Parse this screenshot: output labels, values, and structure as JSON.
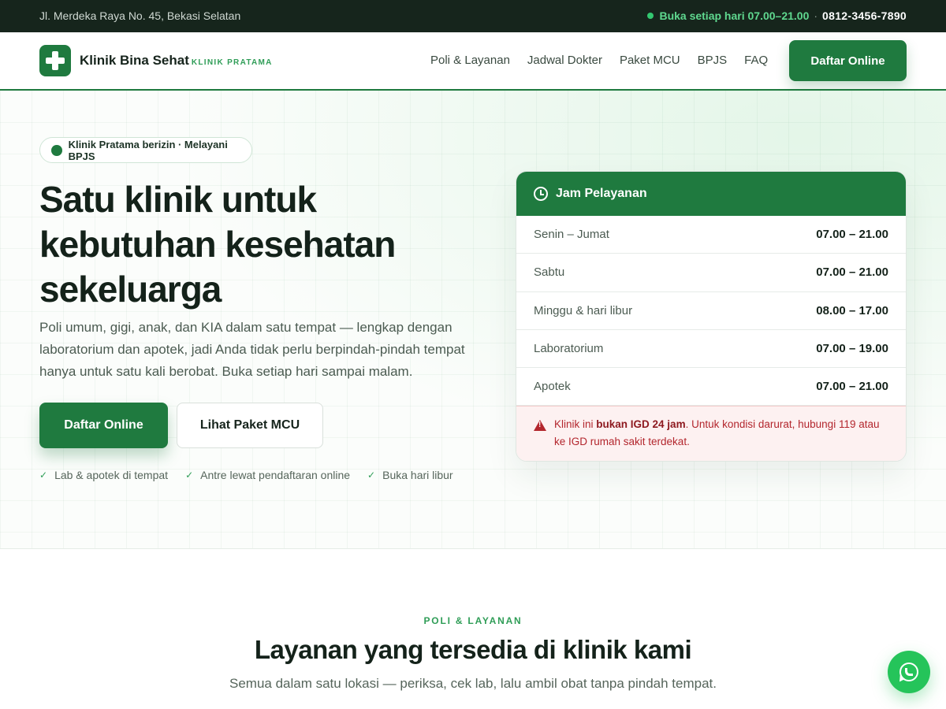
{
  "topbar": {
    "address": "Jl. Merdeka Raya No. 45, Bekasi Selatan",
    "open_status": "Buka setiap hari 07.00–21.00",
    "separator": "·",
    "phone": "0812-3456-7890"
  },
  "header": {
    "brand_name": "Klinik Bina Sehat",
    "brand_sub": "KLINIK PRATAMA",
    "nav": [
      {
        "label": "Poli & Layanan"
      },
      {
        "label": "Jadwal Dokter"
      },
      {
        "label": "Paket MCU"
      },
      {
        "label": "BPJS"
      },
      {
        "label": "FAQ"
      }
    ],
    "cta_label": "Daftar Online"
  },
  "hero": {
    "badge": "Klinik Pratama berizin · Melayani BPJS",
    "title": "Satu klinik untuk kebutuhan kesehatan sekeluarga",
    "description": "Poli umum, gigi, anak, dan KIA dalam satu tempat — lengkap dengan laboratorium dan apotek, jadi Anda tidak perlu berpindah-pindah tempat hanya untuk satu kali berobat. Buka setiap hari sampai malam.",
    "primary_button": "Daftar Online",
    "secondary_button": "Lihat Paket MCU",
    "checks": [
      {
        "label": "Lab & apotek di tempat"
      },
      {
        "label": "Antre lewat pendaftaran online"
      },
      {
        "label": "Buka hari libur"
      }
    ]
  },
  "hours": {
    "title": "Jam Pelayanan",
    "rows": [
      {
        "day": "Senin – Jumat",
        "time": "07.00 – 21.00"
      },
      {
        "day": "Sabtu",
        "time": "07.00 – 21.00"
      },
      {
        "day": "Minggu & hari libur",
        "time": "08.00 – 17.00"
      },
      {
        "day": "Laboratorium",
        "time": "07.00 – 19.00"
      },
      {
        "day": "Apotek",
        "time": "07.00 – 21.00"
      }
    ],
    "alert_prefix": "Klinik ini ",
    "alert_bold": "bukan IGD 24 jam",
    "alert_suffix": ". Untuk kondisi darurat, hubungi 119 atau ke IGD rumah sakit terdekat."
  },
  "section": {
    "eyebrow": "POLI & LAYANAN",
    "title": "Layanan yang tersedia di klinik kami",
    "subtitle": "Semua dalam satu lokasi — periksa, cek lab, lalu ambil obat tanpa pindah tempat."
  },
  "colors": {
    "brand": "#1f7a3f",
    "topbar_bg": "#16251c",
    "accent_green": "#2f9d57",
    "alert_red": "#b3262d",
    "whatsapp": "#25c45a"
  },
  "icons": {
    "logo": "medical-cross-icon",
    "clock": "clock-icon",
    "warning": "warning-triangle-icon",
    "check": "check-icon",
    "whatsapp": "whatsapp-icon"
  }
}
